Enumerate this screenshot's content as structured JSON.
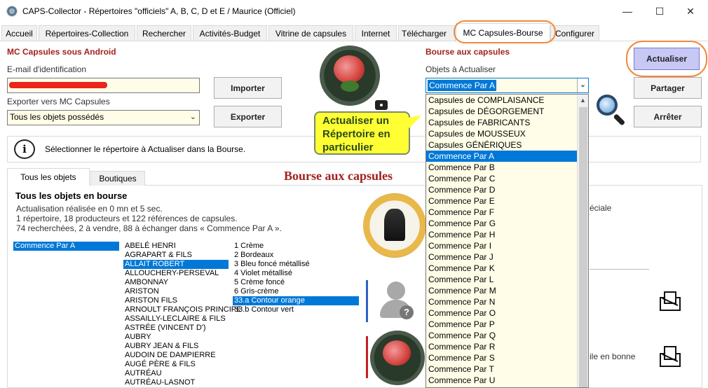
{
  "window": {
    "title": "CAPS-Collector - Répertoires \"officiels\" A, B, C, D et E / Maurice (Officiel)",
    "minimize": "—",
    "maximize": "☐",
    "close": "✕"
  },
  "tabs": [
    {
      "label": "Accueil"
    },
    {
      "label": "Répertoires-Collection"
    },
    {
      "label": "Rechercher"
    },
    {
      "label": "Activités-Budget"
    },
    {
      "label": "Vitrine de capsules"
    },
    {
      "label": "Internet"
    },
    {
      "label": "Télécharger"
    },
    {
      "label": "MC Capsules-Bourse"
    },
    {
      "label": "Configurer"
    }
  ],
  "android": {
    "title": "MC Capsules sous Android",
    "email_label": "E-mail d'identification",
    "export_label": "Exporter vers MC Capsules",
    "export_value": "Tous les objets possédés",
    "import_button": "Importer",
    "export_button": "Exporter"
  },
  "bourse": {
    "title": "Bourse aux capsules",
    "objects_label": "Objets à Actualiser",
    "selected": "Commence Par A",
    "refresh_button": "Actualiser",
    "share_button": "Partager",
    "stop_button": "Arrêter",
    "dropdown_items": [
      "Capsules de COMPLAISANCE",
      "Capsules de DÉGORGEMENT",
      "Capsules de FABRICANTS",
      "Capsules de MOUSSEUX",
      "Capsules GÉNÉRIQUES",
      "Commence Par A",
      "Commence Par B",
      "Commence Par C",
      "Commence Par D",
      "Commence Par E",
      "Commence Par F",
      "Commence Par G",
      "Commence Par H",
      "Commence Par I",
      "Commence Par J",
      "Commence Par K",
      "Commence Par L",
      "Commence Par M",
      "Commence Par N",
      "Commence Par O",
      "Commence Par P",
      "Commence Par Q",
      "Commence Par R",
      "Commence Par S",
      "Commence Par T",
      "Commence Par U"
    ],
    "selected_index": 5
  },
  "callout": {
    "text": "Actualiser un Répertoire en particulier"
  },
  "info": {
    "message": "Sélectionner le répertoire à Actualiser dans la Bourse."
  },
  "subtabs": [
    {
      "label": "Tous les objets"
    },
    {
      "label": "Boutiques"
    }
  ],
  "panel": {
    "heading": "Bourse aux capsules",
    "title": "Tous les objets en bourse",
    "line1": "Actualisation réalisée en 0 mn et 5 sec.",
    "line2": "1 répertoire, 18 producteurs et 122 références de capsules.",
    "line3": "74 recherchées, 2 à vendre, 88 à échanger dans « Commence Par A ».",
    "partial_right1": "éciale",
    "partial_right2": "ile en bonne"
  },
  "lists": {
    "repertoires": [
      "Commence Par A"
    ],
    "producers": [
      "ABELÉ HENRI",
      "AGRAPART & FILS",
      "ALLAIT ROBERT",
      "ALLOUCHERY-PERSEVAL",
      "AMBONNAY",
      "ARISTON",
      "ARISTON FILS",
      "ARNOULT FRANÇOIS PRINCIPE",
      "ASSAILLY-LECLAIRE & FILS",
      "ASTRÉE (VINCENT D')",
      "AUBRY",
      "AUBRY JEAN & FILS",
      "AUDOIN DE DAMPIERRE",
      "AUGÉ PÈRE & FILS",
      "AUTRÉAU",
      "AUTRÉAU-LASNOT"
    ],
    "producers_selected": 2,
    "capsules": [
      "1 Crème",
      "2 Bordeaux",
      "3 Bleu foncé métallisé",
      "4 Violet métallisé",
      "5 Crème foncé",
      "6 Gris-crème",
      "33.a Contour orange",
      "33.b Contour vert"
    ],
    "capsules_selected": 6
  },
  "colors": {
    "accent_red": "#a0221e",
    "selection_blue": "#0078d7",
    "highlight_orange": "#f08a3c",
    "refresh_button_bg": "#c8c8f5",
    "callout_yellow": "#ffff33"
  }
}
